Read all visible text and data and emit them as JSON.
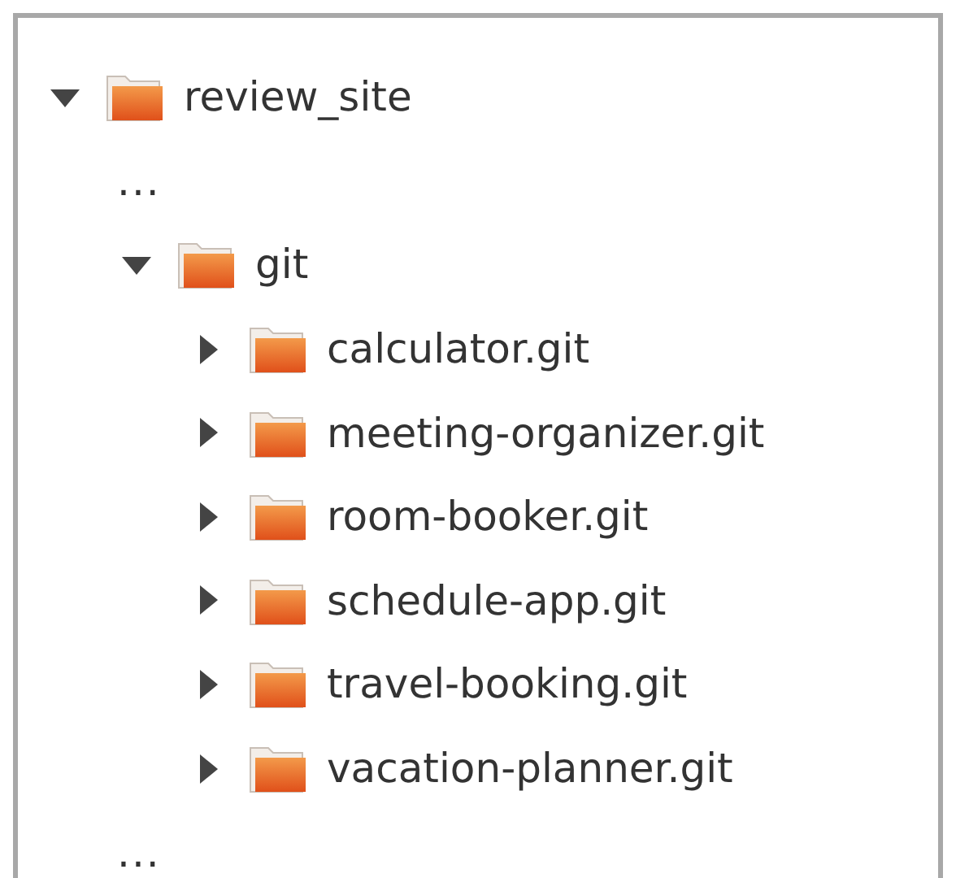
{
  "tree": [
    {
      "kind": "folder",
      "label": "review_site",
      "expanded": true,
      "children": [
        {
          "kind": "ellipsis",
          "label": "..."
        },
        {
          "kind": "folder",
          "label": "git",
          "expanded": true,
          "children": [
            {
              "kind": "folder",
              "label": "calculator.git",
              "expanded": false
            },
            {
              "kind": "folder",
              "label": "meeting-organizer.git",
              "expanded": false
            },
            {
              "kind": "folder",
              "label": "room-booker.git",
              "expanded": false
            },
            {
              "kind": "folder",
              "label": "schedule-app.git",
              "expanded": false
            },
            {
              "kind": "folder",
              "label": "travel-booking.git",
              "expanded": false
            },
            {
              "kind": "folder",
              "label": "vacation-planner.git",
              "expanded": false
            }
          ]
        },
        {
          "kind": "ellipsis",
          "label": "..."
        }
      ]
    }
  ]
}
